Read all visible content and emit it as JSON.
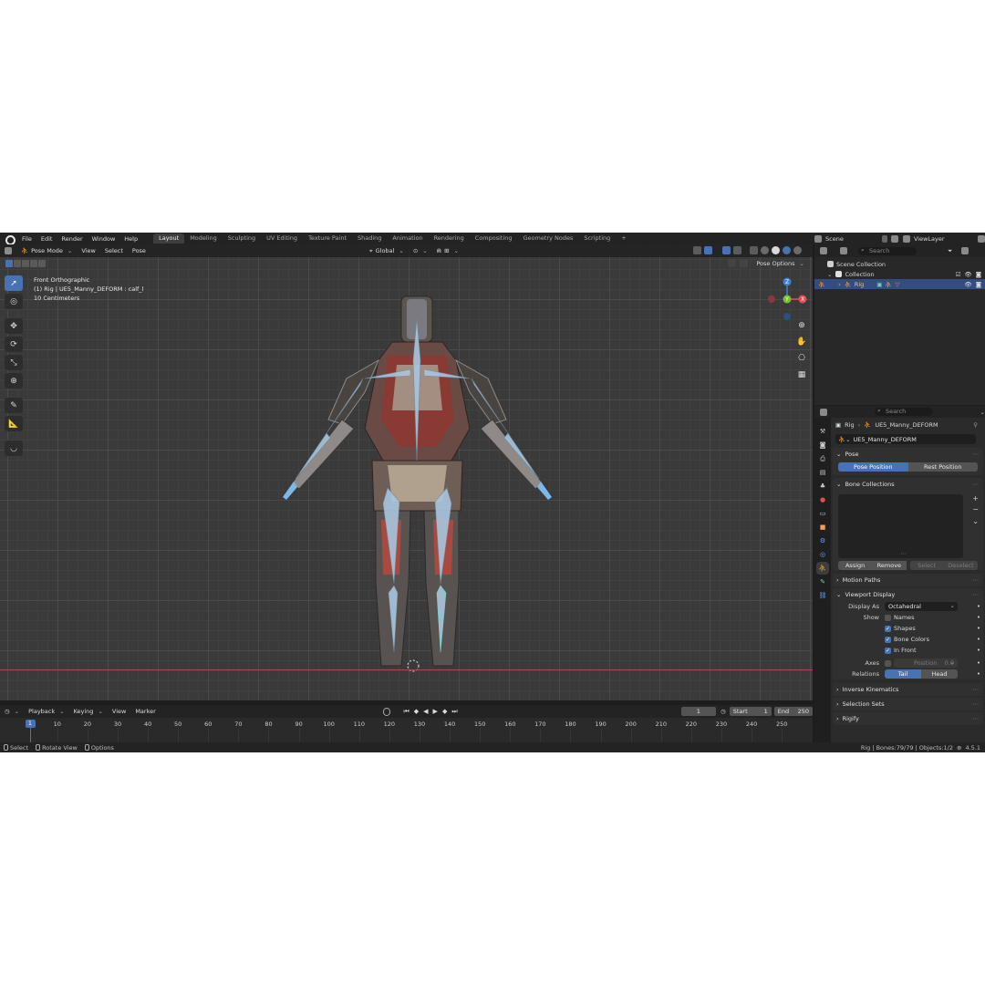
{
  "menu": [
    "File",
    "Edit",
    "Render",
    "Window",
    "Help"
  ],
  "workspaces": [
    {
      "label": "Layout",
      "active": true
    },
    {
      "label": "Modeling",
      "active": false
    },
    {
      "label": "Sculpting",
      "active": false
    },
    {
      "label": "UV Editing",
      "active": false
    },
    {
      "label": "Texture Paint",
      "active": false
    },
    {
      "label": "Shading",
      "active": false
    },
    {
      "label": "Animation",
      "active": false
    },
    {
      "label": "Rendering",
      "active": false
    },
    {
      "label": "Compositing",
      "active": false
    },
    {
      "label": "Geometry Nodes",
      "active": false
    },
    {
      "label": "Scripting",
      "active": false
    }
  ],
  "add_tab": "+",
  "scene": "Scene",
  "view_layer": "ViewLayer",
  "viewport": {
    "mode": "Pose Mode",
    "menus": [
      "View",
      "Select",
      "Pose"
    ],
    "transform_orientation": "Global",
    "overlay_lines": [
      "Front Orthographic",
      "(1) Rig | UE5_Manny_DEFORM : calf_l",
      "10 Centimeters"
    ],
    "pose_options": "Pose Options",
    "gizmo": {
      "x": "X",
      "y": "Y",
      "z": "Z"
    }
  },
  "timeline": {
    "menus": [
      "Playback",
      "Keying",
      "View",
      "Marker"
    ],
    "current_frame": "1",
    "start_label": "Start",
    "start": "1",
    "end_label": "End",
    "end": "250",
    "ticks": [
      "10",
      "20",
      "30",
      "40",
      "50",
      "60",
      "70",
      "80",
      "90",
      "100",
      "110",
      "120",
      "130",
      "140",
      "150",
      "160",
      "170",
      "180",
      "190",
      "200",
      "210",
      "220",
      "230",
      "240",
      "250"
    ],
    "playhead": "1"
  },
  "statusbar": {
    "items": [
      "Select",
      "Rotate View",
      "Options"
    ],
    "info": "Rig | Bones:79/79 | Objects:1/2",
    "version": "4.5.1"
  },
  "outliner": {
    "search_placeholder": "Search",
    "rows": [
      {
        "label": "Scene Collection"
      },
      {
        "label": "Collection"
      },
      {
        "label": "Rig"
      }
    ]
  },
  "properties": {
    "search_placeholder": "Search",
    "breadcrumb": [
      "Rig",
      "UE5_Manny_DEFORM"
    ],
    "armature_name": "UE5_Manny_DEFORM",
    "pose_panel": {
      "title": "Pose",
      "pose_position": "Pose Position",
      "rest_position": "Rest Position"
    },
    "bone_collections": {
      "title": "Bone Collections",
      "assign": "Assign",
      "remove": "Remove",
      "select": "Select",
      "deselect": "Deselect"
    },
    "motion_paths": "Motion Paths",
    "viewport_display": {
      "title": "Viewport Display",
      "display_as_label": "Display As",
      "display_as": "Octahedral",
      "show_label": "Show",
      "names": "Names",
      "names_checked": false,
      "shapes": "Shapes",
      "shapes_checked": true,
      "bone_colors": "Bone Colors",
      "bone_colors_checked": true,
      "in_front": "In Front",
      "in_front_checked": true,
      "axes_label": "Axes",
      "position_label": "Position",
      "position_value": "0.0",
      "relations_label": "Relations",
      "tail": "Tail",
      "head": "Head"
    },
    "inverse_kinematics": "Inverse Kinematics",
    "selection_sets": "Selection Sets",
    "rigify": "Rigify"
  },
  "colors": {
    "accent": "#4772b3",
    "axis_x": "#e44b57",
    "axis_y": "#79c12c",
    "axis_z": "#3f7fd1",
    "selected_row": "#334d80"
  }
}
